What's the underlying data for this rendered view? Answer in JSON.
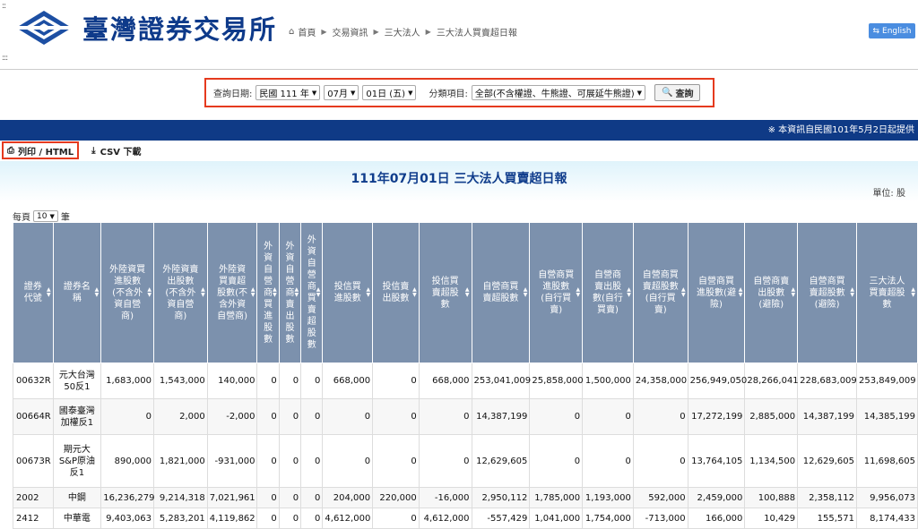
{
  "header": {
    "logo_text": "臺灣證券交易所",
    "breadcrumb": [
      "首頁",
      "交易資訊",
      "三大法人",
      "三大法人買賣超日報"
    ],
    "lang_button": "English"
  },
  "query": {
    "date_label": "查詢日期:",
    "year_select": "民國 111 年",
    "month_select": "07月",
    "day_select": "01日 (五)",
    "category_label": "分類項目:",
    "category_select": "全部(不含權證、牛熊證、可展延牛熊證)",
    "button": "查詢"
  },
  "notice": "※ 本資訊自民國101年5月2日起提供",
  "toolbar": {
    "print": "列印 / HTML",
    "csv": "CSV 下載"
  },
  "report": {
    "title": "111年07月01日 三大法人買賣超日報",
    "unit": "單位: 股",
    "per_page_label": "每頁",
    "per_page_value": "10",
    "per_page_suffix": "筆"
  },
  "table": {
    "headers": [
      "證券代號",
      "證券名稱",
      "外陸資買進股數(不含外資自營商)",
      "外陸資賣出股數(不含外資自營商)",
      "外陸資買賣超股數(不含外資自營商)",
      "外資自營商買進股數",
      "外資自營商賣出股數",
      "外資自營商買賣超股數",
      "投信買進股數",
      "投信賣出股數",
      "投信買賣超股數",
      "自營商買賣超股數",
      "自營商買進股數(自行買賣)",
      "自營商賣出股數(自行買賣)",
      "自營商買賣超股數(自行買賣)",
      "自營商買進股數(避險)",
      "自營商賣出股數(避險)",
      "自營商買賣超股數(避險)",
      "三大法人買賣超股數"
    ],
    "header_display": [
      "證券<br>代號",
      "證券名<br>稱",
      "外陸資買<br>進股數<br>(不含外<br>資自營<br>商)",
      "外陸資賣<br>出股數<br>(不含外<br>資自營<br>商)",
      "外陸資<br>買賣超<br>股數(不<br>含外資<br>自營商)",
      "外<br>資<br>自<br>營<br>商<br>買<br>進<br>股<br>數",
      "外<br>資<br>自<br>營<br>商<br>賣<br>出<br>股<br>數",
      "外<br>資<br>自<br>營<br>商<br>買<br>賣<br>超<br>股<br>數",
      "投信買<br>進股數",
      "投信賣<br>出股數",
      "投信買<br>賣超股<br>數",
      "自營商買<br>賣超股數",
      "自營商買<br>進股數<br>(自行買<br>賣)",
      "自營商<br>賣出股<br>數(自行<br>買賣)",
      "自營商買<br>賣超股數<br>(自行買<br>賣)",
      "自營商買<br>進股數(避<br>險)",
      "自營商賣<br>出股數<br>(避險)",
      "自營商買<br>賣超股數<br>(避險)",
      "三大法人<br>買賣超股<br>數"
    ],
    "rows": [
      [
        "00632R",
        "元大台灣50反1",
        "1,683,000",
        "1,543,000",
        "140,000",
        "0",
        "0",
        "0",
        "668,000",
        "0",
        "668,000",
        "253,041,009",
        "25,858,000",
        "1,500,000",
        "24,358,000",
        "256,949,050",
        "28,266,041",
        "228,683,009",
        "253,849,009"
      ],
      [
        "00664R",
        "國泰臺灣加權反1",
        "0",
        "2,000",
        "-2,000",
        "0",
        "0",
        "0",
        "0",
        "0",
        "0",
        "14,387,199",
        "0",
        "0",
        "0",
        "17,272,199",
        "2,885,000",
        "14,387,199",
        "14,385,199"
      ],
      [
        "00673R",
        "期元大S&P原油反1",
        "890,000",
        "1,821,000",
        "-931,000",
        "0",
        "0",
        "0",
        "0",
        "0",
        "0",
        "12,629,605",
        "0",
        "0",
        "0",
        "13,764,105",
        "1,134,500",
        "12,629,605",
        "11,698,605"
      ],
      [
        "2002",
        "中鋼",
        "16,236,279",
        "9,214,318",
        "7,021,961",
        "0",
        "0",
        "0",
        "204,000",
        "220,000",
        "-16,000",
        "2,950,112",
        "1,785,000",
        "1,193,000",
        "592,000",
        "2,459,000",
        "100,888",
        "2,358,112",
        "9,956,073"
      ],
      [
        "2412",
        "中華電",
        "9,403,063",
        "5,283,201",
        "4,119,862",
        "0",
        "0",
        "0",
        "4,612,000",
        "0",
        "4,612,000",
        "-557,429",
        "1,041,000",
        "1,754,000",
        "-713,000",
        "166,000",
        "10,429",
        "155,571",
        "8,174,433"
      ]
    ],
    "name_display": [
      "元大台灣<br>50反1",
      "國泰臺灣<br>加權反1",
      "期元大<br>S&P原油<br>反1",
      "中鋼",
      "中華電"
    ]
  }
}
